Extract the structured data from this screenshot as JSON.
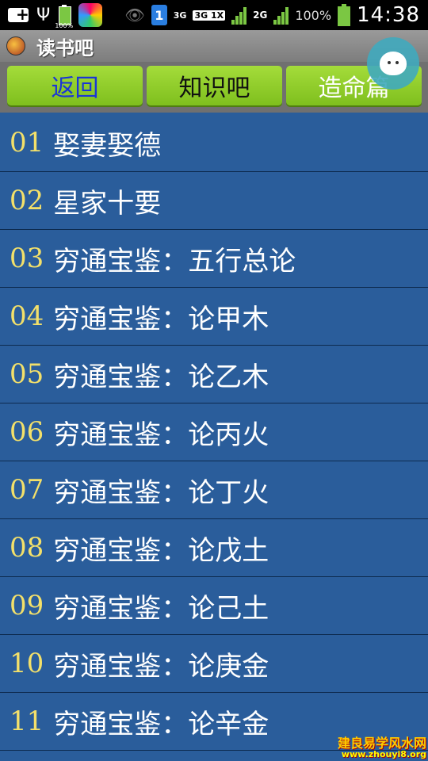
{
  "status": {
    "battery_small": "100%",
    "signal_3g": "3G",
    "signal_3g1x": "3G 1X",
    "signal_2g": "2G",
    "battery_pct": "100%",
    "time": "14:38",
    "sim": "1"
  },
  "app": {
    "title": "读书吧"
  },
  "tabs": [
    {
      "label": "返回"
    },
    {
      "label": "知识吧"
    },
    {
      "label": "造命篇"
    }
  ],
  "items": [
    {
      "num": "01",
      "title": "娶妻娶德"
    },
    {
      "num": "02",
      "title": "星家十要"
    },
    {
      "num": "03",
      "title": "穷通宝鉴：五行总论"
    },
    {
      "num": "04",
      "title": "穷通宝鉴：论甲木"
    },
    {
      "num": "05",
      "title": "穷通宝鉴：论乙木"
    },
    {
      "num": "06",
      "title": "穷通宝鉴：论丙火"
    },
    {
      "num": "07",
      "title": "穷通宝鉴：论丁火"
    },
    {
      "num": "08",
      "title": "穷通宝鉴：论戊土"
    },
    {
      "num": "09",
      "title": "穷通宝鉴：论己土"
    },
    {
      "num": "10",
      "title": "穷通宝鉴：论庚金"
    },
    {
      "num": "11",
      "title": "穷通宝鉴：论辛金"
    }
  ],
  "watermark": {
    "name": "建良易学风水网",
    "url": "www.zhouyi8.org"
  }
}
